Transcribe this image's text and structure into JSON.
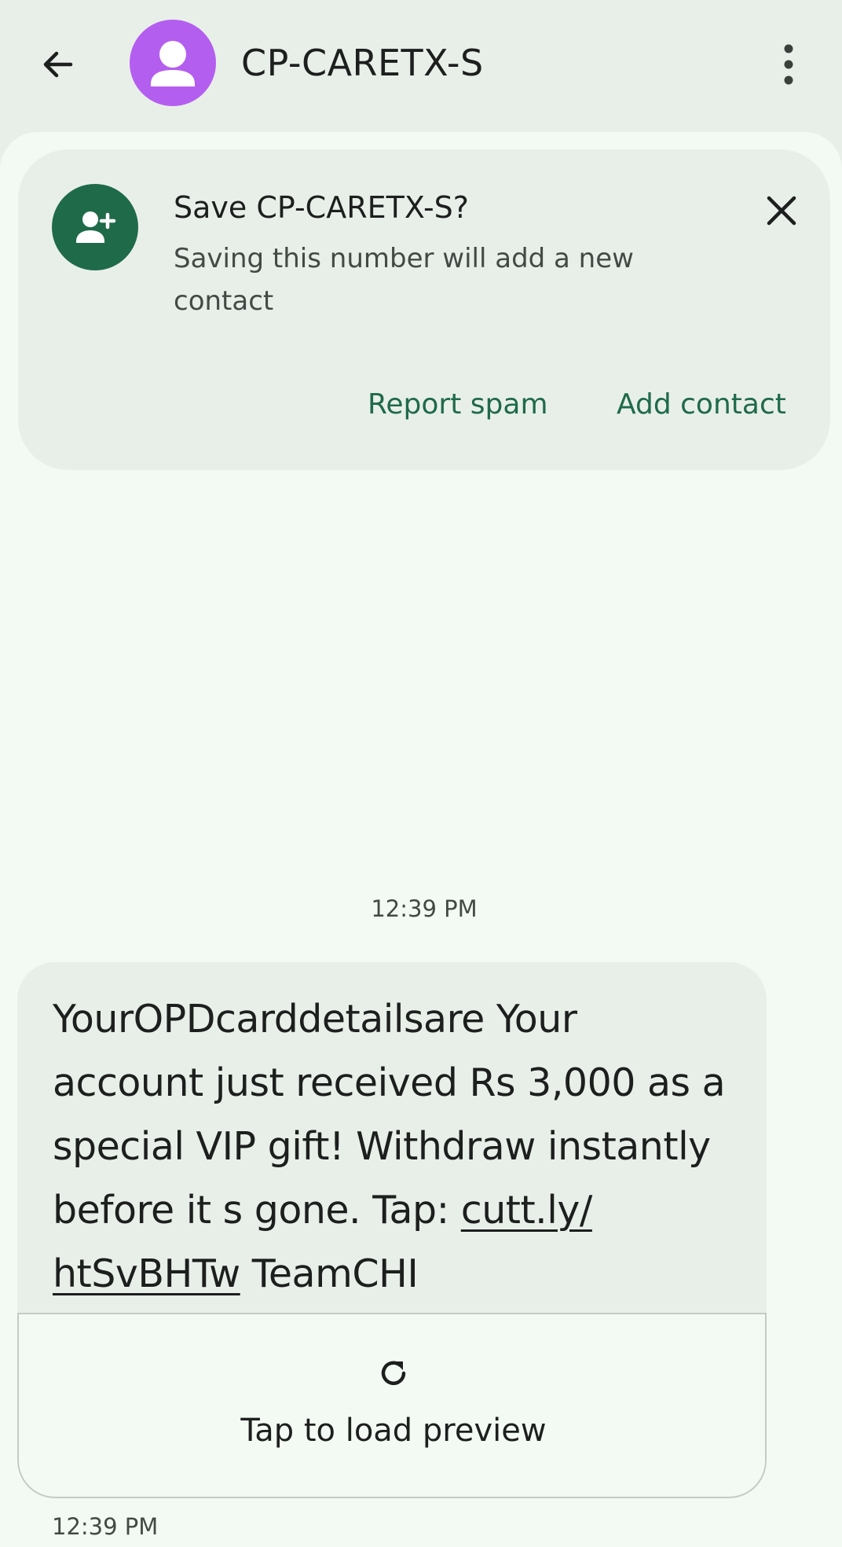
{
  "header": {
    "title": "CP-CARETX-S",
    "avatar_color": "#b45ef0",
    "icons": {
      "back": "arrow-left-icon",
      "avatar": "person-icon",
      "more": "more-vert-icon"
    }
  },
  "save_card": {
    "title": "Save CP-CARETX-S?",
    "description": "Saving this number will add a new contact",
    "report_spam_label": "Report spam",
    "add_contact_label": "Add contact",
    "accent_color": "#1f6a49",
    "icons": {
      "contact": "person-add-icon",
      "close": "close-icon"
    }
  },
  "conversation": {
    "date_separator": "12:39 PM",
    "message": {
      "text_before_link": "YourOPDcarddetailsare Your account just received Rs 3,000 as a special VIP gift! Withdraw instantly before it s gone. Tap: ",
      "link_line1": "cutt.ly/",
      "link_line2": "htSvBHTw",
      "text_after_link": " TeamCHI",
      "preview_label": "Tap to load preview",
      "preview_icon": "refresh-icon",
      "timestamp": "12:39 PM"
    }
  }
}
